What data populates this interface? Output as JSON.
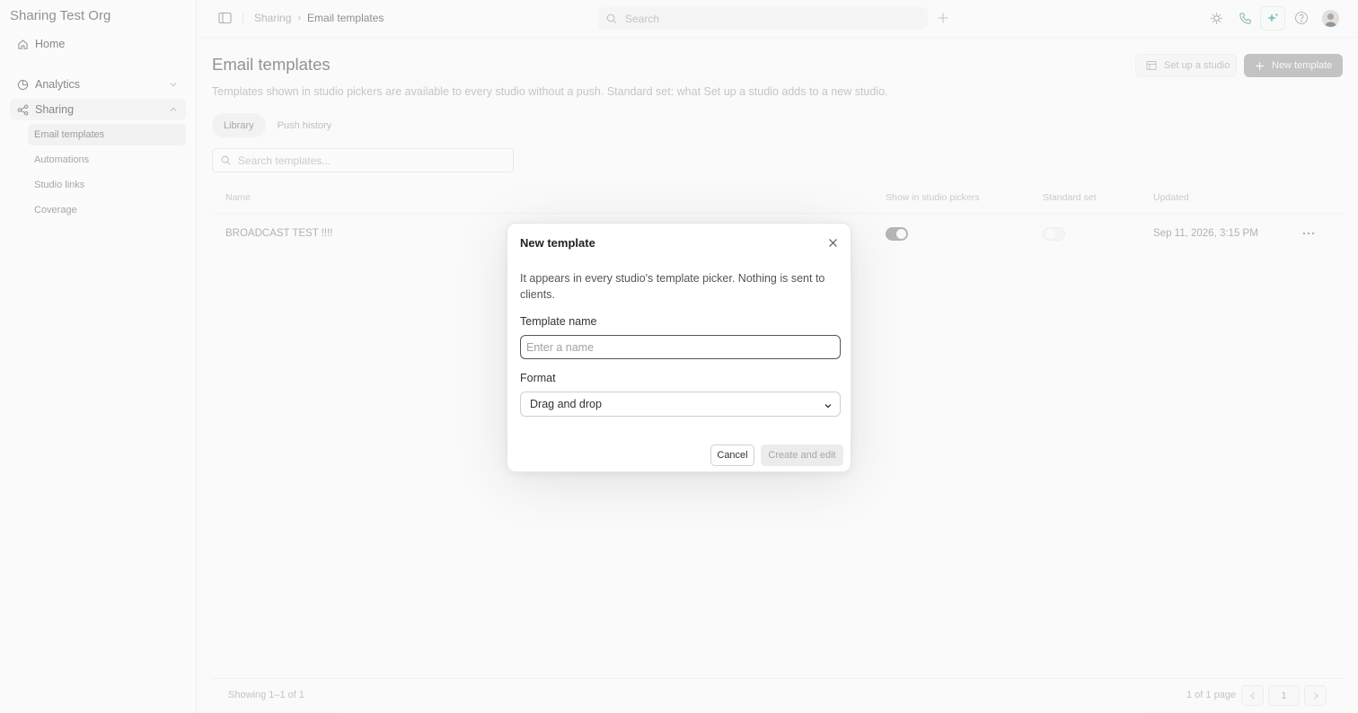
{
  "sidebar": {
    "org_name": "Sharing Test Org",
    "items": [
      {
        "label": "Home",
        "icon": "home-icon"
      },
      {
        "label": "Analytics",
        "icon": "analytics-icon"
      },
      {
        "label": "Sharing",
        "icon": "share-icon"
      }
    ],
    "sub_items": [
      {
        "label": "Email templates"
      },
      {
        "label": "Automations"
      },
      {
        "label": "Studio links"
      },
      {
        "label": "Coverage"
      }
    ]
  },
  "header": {
    "breadcrumb": [
      "Sharing",
      "Email templates"
    ],
    "search_placeholder": "Search"
  },
  "main": {
    "title": "Email templates",
    "description": "Templates shown in studio pickers are available to every studio without a push. Standard set: what Set up a studio adds to a new studio.",
    "setup_label": "Set up a studio",
    "new_label": "New template",
    "tabs": [
      {
        "label": "Library"
      },
      {
        "label": "Push history"
      }
    ],
    "search_placeholder": "Search templates...",
    "columns": [
      "Name",
      "Show in studio pickers",
      "Standard set",
      "Updated"
    ],
    "rows": [
      {
        "name": "BROADCAST TEST !!!!",
        "show_in_pickers": true,
        "standard_set": false,
        "updated": "Sep 11, 2026, 3:15 PM"
      }
    ],
    "showing": "Showing 1–1 of 1",
    "page_of": "1 of 1 page",
    "page_number": "1"
  },
  "modal": {
    "title": "New template",
    "description": "It appears in every studio's template picker. Nothing is sent to clients.",
    "name_label": "Template name",
    "name_placeholder": "Enter a name",
    "name_value": "",
    "format_label": "Format",
    "format_value": "Drag and drop",
    "cancel_label": "Cancel",
    "create_label": "Create and edit"
  }
}
